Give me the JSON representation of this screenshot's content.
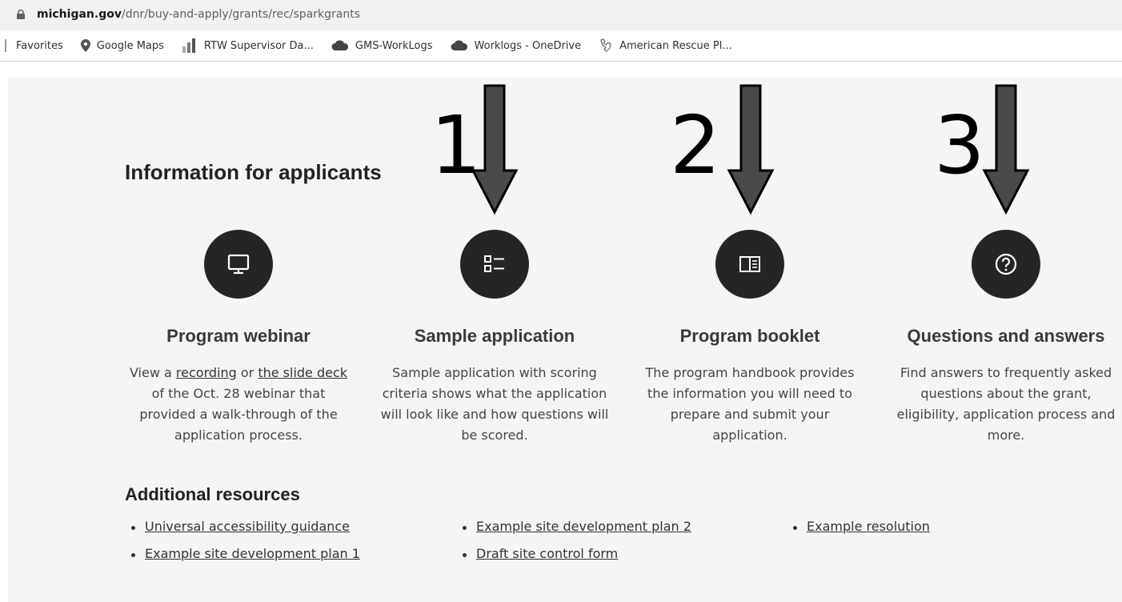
{
  "browser": {
    "url_domain": "michigan.gov",
    "url_path": "/dnr/buy-and-apply/grants/rec/sparkgrants",
    "bookmarks": [
      {
        "label": "Favorites",
        "icon": "folder-icon"
      },
      {
        "label": "Google Maps",
        "icon": "map-pin-icon"
      },
      {
        "label": "RTW Supervisor Da...",
        "icon": "bar-chart-icon"
      },
      {
        "label": "GMS-WorkLogs",
        "icon": "cloud-icon"
      },
      {
        "label": "Worklogs - OneDrive",
        "icon": "cloud-icon"
      },
      {
        "label": "American Rescue Pl...",
        "icon": "michigan-map-icon"
      }
    ]
  },
  "page": {
    "heading": "Information for applicants",
    "markers": [
      "1",
      "2",
      "3"
    ],
    "cards": [
      {
        "icon": "monitor-icon",
        "title": "Program webinar",
        "desc_pre": "View a ",
        "link1": "recording",
        "desc_mid": " or ",
        "link2": "the slide deck",
        "desc_post": " of the Oct. 28 webinar that provided a walk-through of the application process."
      },
      {
        "icon": "list-icon",
        "title": "Sample application",
        "desc": "Sample application with scoring criteria shows what the application will look like and how questions will be scored."
      },
      {
        "icon": "booklet-icon",
        "title": "Program booklet",
        "desc": "The program handbook provides the information you will need to prepare and submit your application."
      },
      {
        "icon": "question-icon",
        "title": "Questions and answers",
        "desc": "Find answers to frequently asked questions about the grant, eligibility, application process and more."
      }
    ],
    "additional_heading": "Additional resources",
    "resources": [
      "Universal accessibility guidance",
      "Example site development plan 1",
      "Example site development plan 2",
      "Draft site control form",
      "Example resolution"
    ]
  },
  "colors": {
    "circle": "#252525",
    "arrow_fill": "#4a4a4a",
    "page_bg": "#f5f5f5"
  }
}
